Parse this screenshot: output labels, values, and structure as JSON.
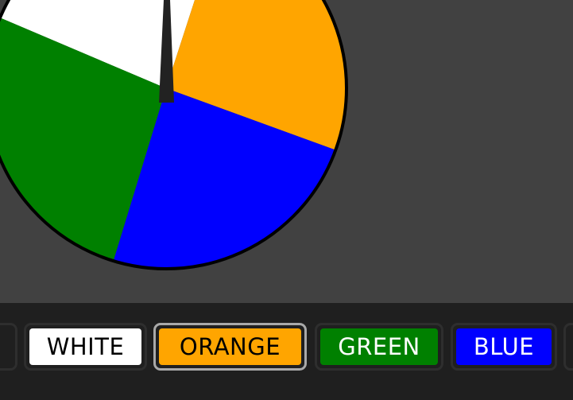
{
  "wheel": {
    "segments": [
      {
        "label": "WHITE",
        "color": "#ffffff"
      },
      {
        "label": "ORANGE",
        "color": "#ffa500"
      },
      {
        "label": "BLUE",
        "color": "#0000ff"
      },
      {
        "label": "GREEN",
        "color": "#008000"
      }
    ],
    "rim_color": "#000000",
    "pointer_color": "#222222"
  },
  "color_options": [
    {
      "label": "",
      "bg": "#1f1f1f",
      "text_color": "#000000",
      "selected": false
    },
    {
      "label": "WHITE",
      "bg": "#ffffff",
      "text_color": "#000000",
      "selected": false
    },
    {
      "label": "ORANGE",
      "bg": "#ffa500",
      "text_color": "#000000",
      "selected": true
    },
    {
      "label": "GREEN",
      "bg": "#008000",
      "text_color": "#ffffff",
      "selected": false
    },
    {
      "label": "BLUE",
      "bg": "#0000ff",
      "text_color": "#ffffff",
      "selected": false
    },
    {
      "label": "",
      "bg": "#1f1f1f",
      "text_color": "#000000",
      "selected": false
    }
  ]
}
